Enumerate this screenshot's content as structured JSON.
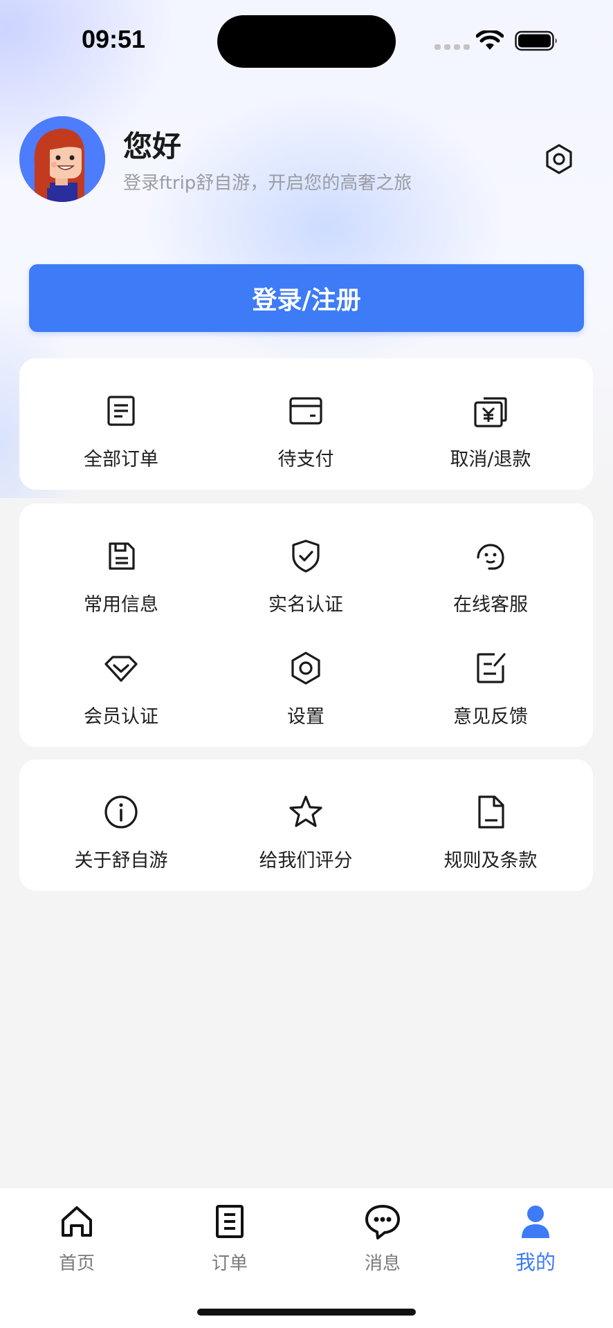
{
  "status_bar": {
    "time": "09:51"
  },
  "profile": {
    "greeting": "您好",
    "subtitle": "登录ftrip舒自游，开启您的高奢之旅"
  },
  "login_button": "登录/注册",
  "orders": [
    {
      "label": "全部订单",
      "icon": "order-list-icon"
    },
    {
      "label": "待支付",
      "icon": "wallet-icon"
    },
    {
      "label": "取消/退款",
      "icon": "refund-icon"
    }
  ],
  "services": [
    {
      "label": "常用信息",
      "icon": "save-disk-icon"
    },
    {
      "label": "实名认证",
      "icon": "shield-check-icon"
    },
    {
      "label": "在线客服",
      "icon": "headset-icon"
    },
    {
      "label": "会员认证",
      "icon": "diamond-icon"
    },
    {
      "label": "设置",
      "icon": "gear-icon"
    },
    {
      "label": "意见反馈",
      "icon": "edit-icon"
    }
  ],
  "about": [
    {
      "label": "关于舒自游",
      "icon": "info-icon"
    },
    {
      "label": "给我们评分",
      "icon": "star-icon"
    },
    {
      "label": "规则及条款",
      "icon": "document-icon"
    }
  ],
  "tabbar": [
    {
      "label": "首页",
      "icon": "home-icon",
      "active": false
    },
    {
      "label": "订单",
      "icon": "order-icon",
      "active": false
    },
    {
      "label": "消息",
      "icon": "message-icon",
      "active": false
    },
    {
      "label": "我的",
      "icon": "user-icon",
      "active": true
    }
  ],
  "colors": {
    "accent": "#3d7bf7",
    "avatar_bg": "#4d7cfc"
  }
}
